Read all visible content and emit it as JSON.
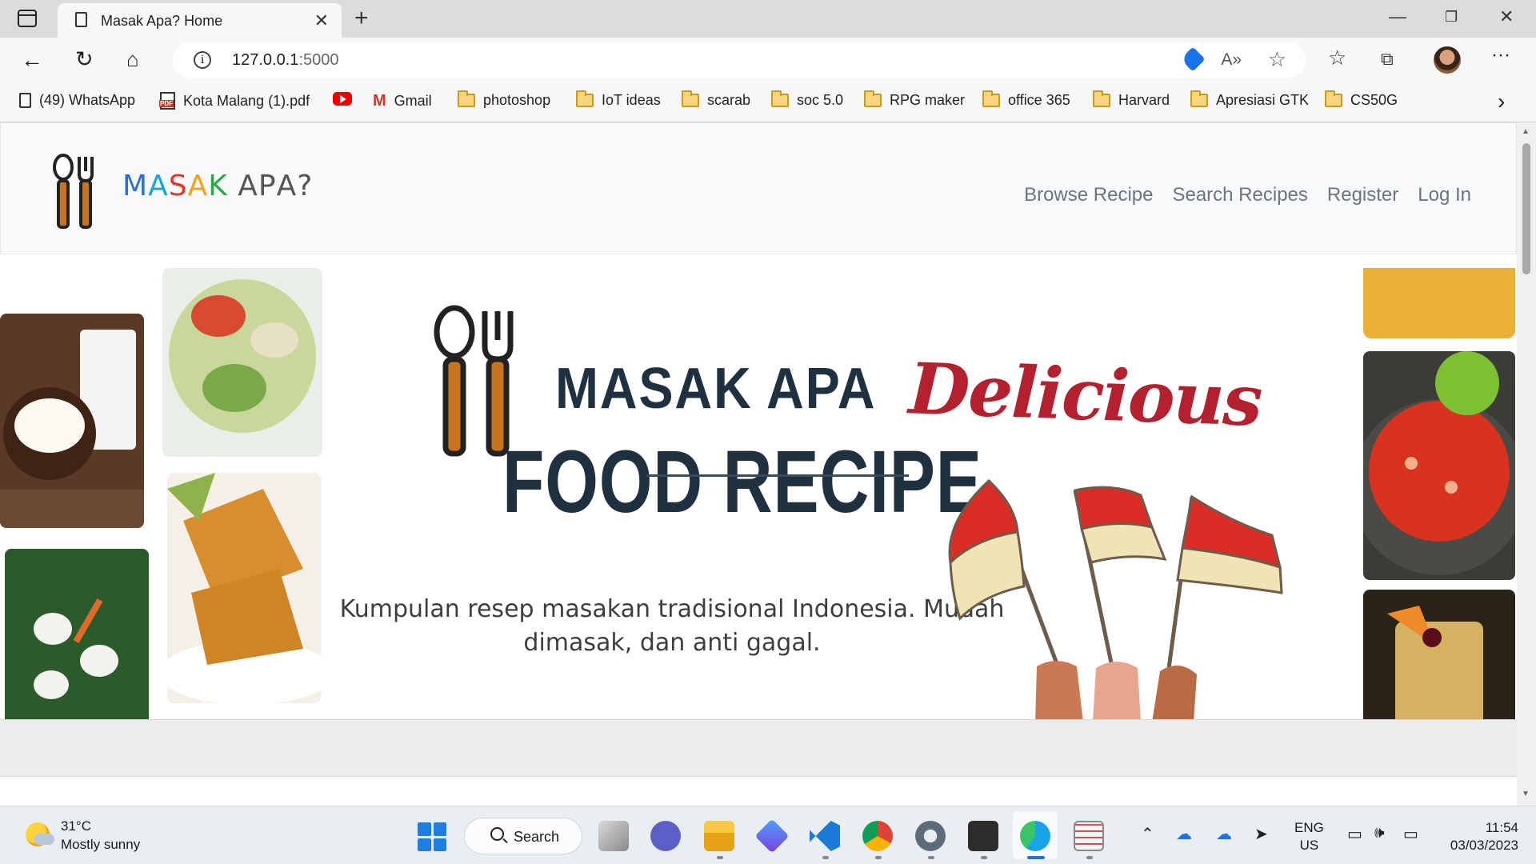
{
  "browser": {
    "tab_title": "Masak Apa? Home",
    "url_host": "127.0.0.1",
    "url_port": ":5000",
    "bookmarks": [
      {
        "label": "(49) WhatsApp",
        "icon": "page-icon"
      },
      {
        "label": "Kota Malang (1).pdf",
        "icon": "pdf-icon"
      },
      {
        "label": "",
        "icon": "youtube-icon"
      },
      {
        "label": "Gmail",
        "icon": "gmail-icon"
      },
      {
        "label": "photoshop",
        "icon": "folder-icon"
      },
      {
        "label": "IoT ideas",
        "icon": "folder-icon"
      },
      {
        "label": "scarab",
        "icon": "folder-icon"
      },
      {
        "label": "soc 5.0",
        "icon": "folder-icon"
      },
      {
        "label": "RPG maker",
        "icon": "folder-icon"
      },
      {
        "label": "office 365",
        "icon": "folder-icon"
      },
      {
        "label": "Harvard",
        "icon": "folder-icon"
      },
      {
        "label": "Apresiasi GTK",
        "icon": "folder-icon"
      },
      {
        "label": "CS50G",
        "icon": "folder-icon"
      }
    ]
  },
  "site": {
    "brand": [
      "M",
      "A",
      "S",
      "A",
      "K",
      " ",
      "A",
      "P",
      "A",
      "?"
    ],
    "brand_colors": [
      "#2b6de0",
      "#1aa3d9",
      "#e4362d",
      "#f4a21d",
      "#2aa84a",
      "#555555",
      "#555555",
      "#555555",
      "#555555",
      "#555555"
    ],
    "nav": {
      "browse": "Browse Recipe",
      "search": "Search Recipes",
      "register": "Register",
      "login": "Log In"
    },
    "hero": {
      "title_top": "MASAK APA",
      "title_main": "FOOD RECIPE",
      "script_word": "Delicious",
      "tagline_line1": "Kumpulan resep masakan tradisional Indonesia. Mudah",
      "tagline_line2": "dimasak, dan anti gagal."
    },
    "colors": {
      "dark_title": "#1f3040",
      "script_red": "#b3202e",
      "flag_red": "#d92d25",
      "flag_cream": "#f1e3b3",
      "utensil_orange": "#c8741f",
      "tile_gold": "#e9b035"
    }
  },
  "taskbar": {
    "weather_temp": "31°C",
    "weather_desc": "Mostly sunny",
    "search_label": "Search",
    "lang_line1": "ENG",
    "lang_line2": "US",
    "time": "11:54",
    "date": "03/03/2023"
  }
}
